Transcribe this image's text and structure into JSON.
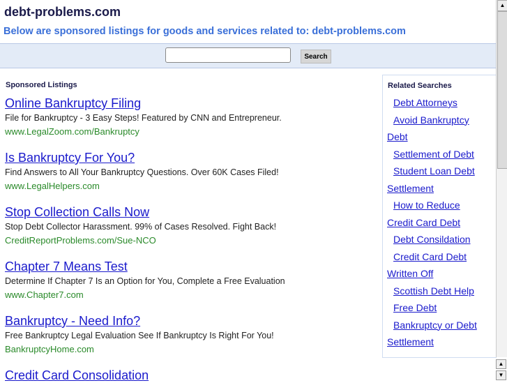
{
  "header": {
    "title": "debt-problems.com",
    "subtitle": "Below are sponsored listings for goods and services related to: debt-problems.com"
  },
  "search": {
    "value": "",
    "button": "Search"
  },
  "sponsored": {
    "heading": "Sponsored Listings",
    "listings": [
      {
        "title": "Online Bankruptcy Filing",
        "desc": "File for Bankruptcy - 3 Easy Steps! Featured by CNN and Entrepreneur.",
        "url": "www.LegalZoom.com/Bankruptcy"
      },
      {
        "title": "Is Bankruptcy For You?",
        "desc": "Find Answers to All Your Bankruptcy Questions. Over 60K Cases Filed!",
        "url": "www.LegalHelpers.com"
      },
      {
        "title": "Stop Collection Calls Now",
        "desc": "Stop Debt Collector Harassment. 99% of Cases Resolved. Fight Back!",
        "url": "CreditReportProblems.com/Sue-NCO"
      },
      {
        "title": "Chapter 7 Means Test",
        "desc": "Determine If Chapter 7 Is an Option for You, Complete a Free Evaluation",
        "url": "www.Chapter7.com"
      },
      {
        "title": "Bankruptcy - Need Info?",
        "desc": "Free Bankruptcy Legal Evaluation See If Bankruptcy Is Right For You!",
        "url": "BankruptcyHome.com"
      },
      {
        "title": "Credit Card Consolidation"
      }
    ]
  },
  "related": {
    "heading": "Related Searches",
    "items": [
      "Debt Attorneys",
      "Avoid Bankruptcy",
      "Debt",
      "Settlement of Debt",
      "Student Loan Debt",
      "Settlement",
      "How to Reduce",
      "Credit Card Debt",
      "Debt Consildation",
      "Credit Card Debt",
      "Written Off",
      "Scottish Debt Help",
      "Free Debt",
      "Bankruptcy or Debt",
      "Settlement"
    ]
  }
}
